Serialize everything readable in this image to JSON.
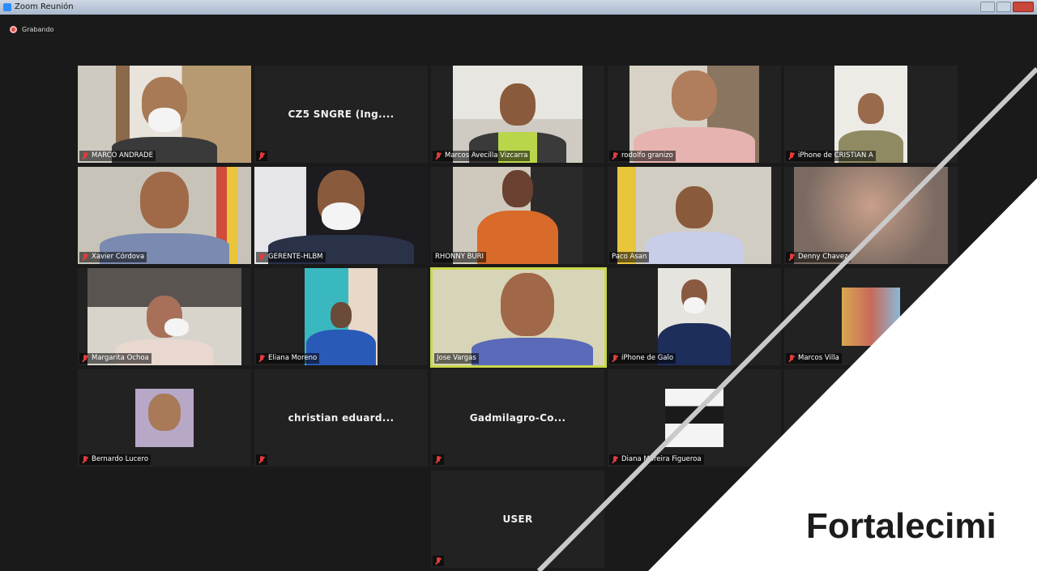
{
  "window": {
    "title": "Zoom Reunión"
  },
  "recording": {
    "label": "Grabando"
  },
  "participants": [
    {
      "name": "MARCO ANDRADE",
      "muted": true,
      "video": true
    },
    {
      "name": "",
      "display_label": "CZ5 SNGRE (Ing....",
      "muted": true,
      "video": false
    },
    {
      "name": "Marcos Avecilla Vizcarra",
      "muted": true,
      "video": true
    },
    {
      "name": "rodolfo granizo",
      "muted": true,
      "video": true
    },
    {
      "name": "iPhone de CRISTIAN A",
      "muted": true,
      "video": true
    },
    {
      "name": "Xavier Córdova",
      "muted": true,
      "video": true
    },
    {
      "name": "GERENTE-HLBM",
      "muted": true,
      "video": true
    },
    {
      "name": "RHONNY BURI",
      "muted": false,
      "video": true
    },
    {
      "name": "Paco Asan",
      "muted": false,
      "video": true
    },
    {
      "name": "Denny Chavez",
      "muted": true,
      "video": true
    },
    {
      "name": "Margarita Ochoa",
      "muted": true,
      "video": true
    },
    {
      "name": "Eliana Moreno",
      "muted": true,
      "video": true
    },
    {
      "name": "Jose Vargas",
      "muted": false,
      "video": true,
      "active_speaker": true
    },
    {
      "name": "iPhone de Galo",
      "muted": true,
      "video": true
    },
    {
      "name": "Marcos Villa",
      "muted": true,
      "video": true
    },
    {
      "name": "Bernardo Lucero",
      "muted": true,
      "video": true
    },
    {
      "name": "",
      "display_label": "christian eduard...",
      "muted": true,
      "video": false
    },
    {
      "name": "",
      "display_label": "Gadmilagro-Co...",
      "muted": true,
      "video": false
    },
    {
      "name": "Diana Moreira Figueroa",
      "muted": true,
      "video": true
    },
    {
      "name": "",
      "display_label": "USER",
      "muted": true,
      "video": false
    }
  ],
  "overlay": {
    "brand_text": "Fortalecimi"
  },
  "colors": {
    "background": "#1a1a1a",
    "tile": "#222222",
    "active_speaker_border": "#c9d84a",
    "muted_icon": "#e23b3b"
  }
}
